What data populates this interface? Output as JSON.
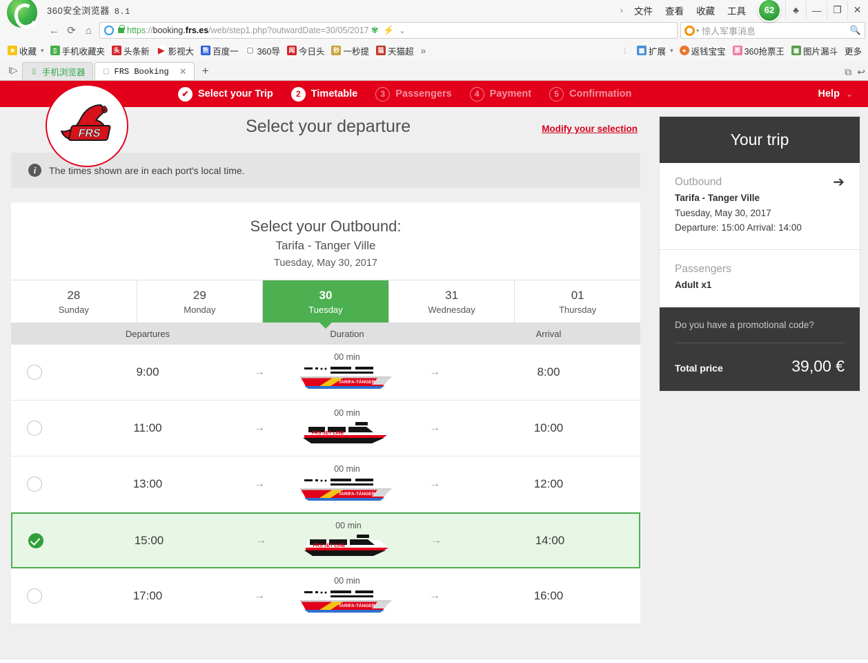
{
  "browser": {
    "title": "360安全浏览器",
    "version": "8.1",
    "menus": [
      "文件",
      "查看",
      "收藏",
      "工具"
    ],
    "safety_score": "62",
    "window_controls": {
      "skin": "shirt-icon",
      "minimize": "—",
      "maximize": "❐",
      "close": "✕"
    },
    "nav": {
      "back": "←",
      "reload": "⟳",
      "home": "⌂"
    },
    "url": {
      "scheme": "https",
      "separator": "://",
      "host_prefix": "booking.",
      "host_bold": "frs.es",
      "path": "/web/step1.php?outwardDate=30/05/2017"
    },
    "addr_icons": [
      "translate-icon",
      "lightning-icon",
      "chevron-down-icon"
    ],
    "search": {
      "value": "惊人军事消息",
      "engine": "so-logo-icon"
    },
    "bookmarks": [
      {
        "label": "收藏",
        "icon": "star-icon",
        "color": "#f5c518",
        "glyph": "★"
      },
      {
        "label": "手机收藏夹",
        "icon": "phone-icon",
        "color": "#ffffff",
        "glyph": "▯"
      },
      {
        "label": "头条新",
        "icon": "news-icon",
        "color": "#d4232a",
        "glyph": "头"
      },
      {
        "label": "影视大",
        "icon": "video-icon",
        "color": "#ffffff",
        "glyph": "▶"
      },
      {
        "label": "百度一",
        "icon": "baidu-icon",
        "color": "#2b5fd9",
        "glyph": "熊"
      },
      {
        "label": "360导",
        "icon": "page-icon",
        "color": "#ffffff",
        "glyph": "▢"
      },
      {
        "label": "今日头",
        "icon": "toutiao-icon",
        "color": "#d4232a",
        "glyph": "闻"
      },
      {
        "label": "一秒提",
        "icon": "tip-icon",
        "color": "#caa23a",
        "glyph": "秒"
      },
      {
        "label": "天猫超",
        "icon": "tmall-icon",
        "color": "#c0392b",
        "glyph": "猫"
      }
    ],
    "bookmarks_overflow": "»",
    "toolbar_right": [
      {
        "label": "扩展",
        "icon": "extensions-icon",
        "color": "#4a90d9",
        "glyph": "▦"
      },
      {
        "label": "返钱宝宝",
        "icon": "wallet-icon",
        "color": "#e8762b",
        "glyph": "●"
      },
      {
        "label": "360抢票王",
        "icon": "ticket-icon",
        "color": "#f07ba0",
        "glyph": "票"
      },
      {
        "label": "图片漏斗",
        "icon": "image-icon",
        "color": "#5aa04a",
        "glyph": "▣"
      },
      {
        "label": "更多",
        "icon": "more-icon",
        "color": "transparent",
        "glyph": ""
      }
    ],
    "tabs": [
      {
        "label": "手机浏览器",
        "favicon": "phone-icon",
        "active": false
      },
      {
        "label": "FRS Booking",
        "favicon": "page-icon",
        "active": true
      }
    ],
    "tab_close": "✕",
    "new_tab": "+",
    "tabs_right_icons": [
      "restore-tab-icon",
      "undo-icon"
    ],
    "tab_list_arrow": "I▷"
  },
  "site": {
    "logo_text": "FRS",
    "brand_color": "#e2001a",
    "steps": [
      {
        "num": "✔",
        "label": "Select your Trip",
        "state": "done"
      },
      {
        "num": "2",
        "label": "Timetable",
        "state": "current"
      },
      {
        "num": "3",
        "label": "Passengers",
        "state": "todo"
      },
      {
        "num": "4",
        "label": "Payment",
        "state": "todo"
      },
      {
        "num": "5",
        "label": "Confirmation",
        "state": "todo"
      }
    ],
    "help": {
      "label": "Help",
      "caret": "⌄"
    }
  },
  "main": {
    "page_title": "Select your departure",
    "modify_link": "Modify your selection",
    "notice": "The times shown are in each port's local time.",
    "panel": {
      "heading": "Select your Outbound:",
      "route": "Tarifa - Tanger Ville",
      "date": "Tuesday, May 30, 2017"
    },
    "day_tabs": [
      {
        "num": "28",
        "name": "Sunday",
        "selected": false
      },
      {
        "num": "29",
        "name": "Monday",
        "selected": false
      },
      {
        "num": "30",
        "name": "Tuesday",
        "selected": true
      },
      {
        "num": "31",
        "name": "Wednesday",
        "selected": false
      },
      {
        "num": "01",
        "name": "Thursday",
        "selected": false
      }
    ],
    "table_headers": {
      "departures": "Departures",
      "duration": "Duration",
      "arrival": "Arrival"
    },
    "arrow_glyph": "→",
    "trips": [
      {
        "departure": "9:00",
        "duration": "00 min",
        "arrival": "8:00",
        "vessel": "tarifa-tanger-ferry",
        "selected": false
      },
      {
        "departure": "11:00",
        "duration": "00 min",
        "arrival": "10:00",
        "vessel": "frs-jet-line",
        "selected": false
      },
      {
        "departure": "13:00",
        "duration": "00 min",
        "arrival": "12:00",
        "vessel": "tarifa-tanger-ferry",
        "selected": false
      },
      {
        "departure": "15:00",
        "duration": "00 min",
        "arrival": "14:00",
        "vessel": "frs-jet-line",
        "selected": true
      },
      {
        "departure": "17:00",
        "duration": "00 min",
        "arrival": "16:00",
        "vessel": "tarifa-tanger-ferry",
        "selected": false
      }
    ]
  },
  "sidebar": {
    "card_title": "Your trip",
    "outbound": {
      "label": "Outbound",
      "route": "Tarifa - Tanger Ville",
      "date": "Tuesday, May 30, 2017",
      "times": "Departure: 15:00 Arrival: 14:00",
      "icon": "➔"
    },
    "passengers": {
      "label": "Passengers",
      "value": "Adult x1",
      "icon": "person-icon"
    },
    "promo": {
      "question": "Do you have a promotional code?"
    },
    "total": {
      "label": "Total price",
      "value": "39,00 €"
    }
  }
}
